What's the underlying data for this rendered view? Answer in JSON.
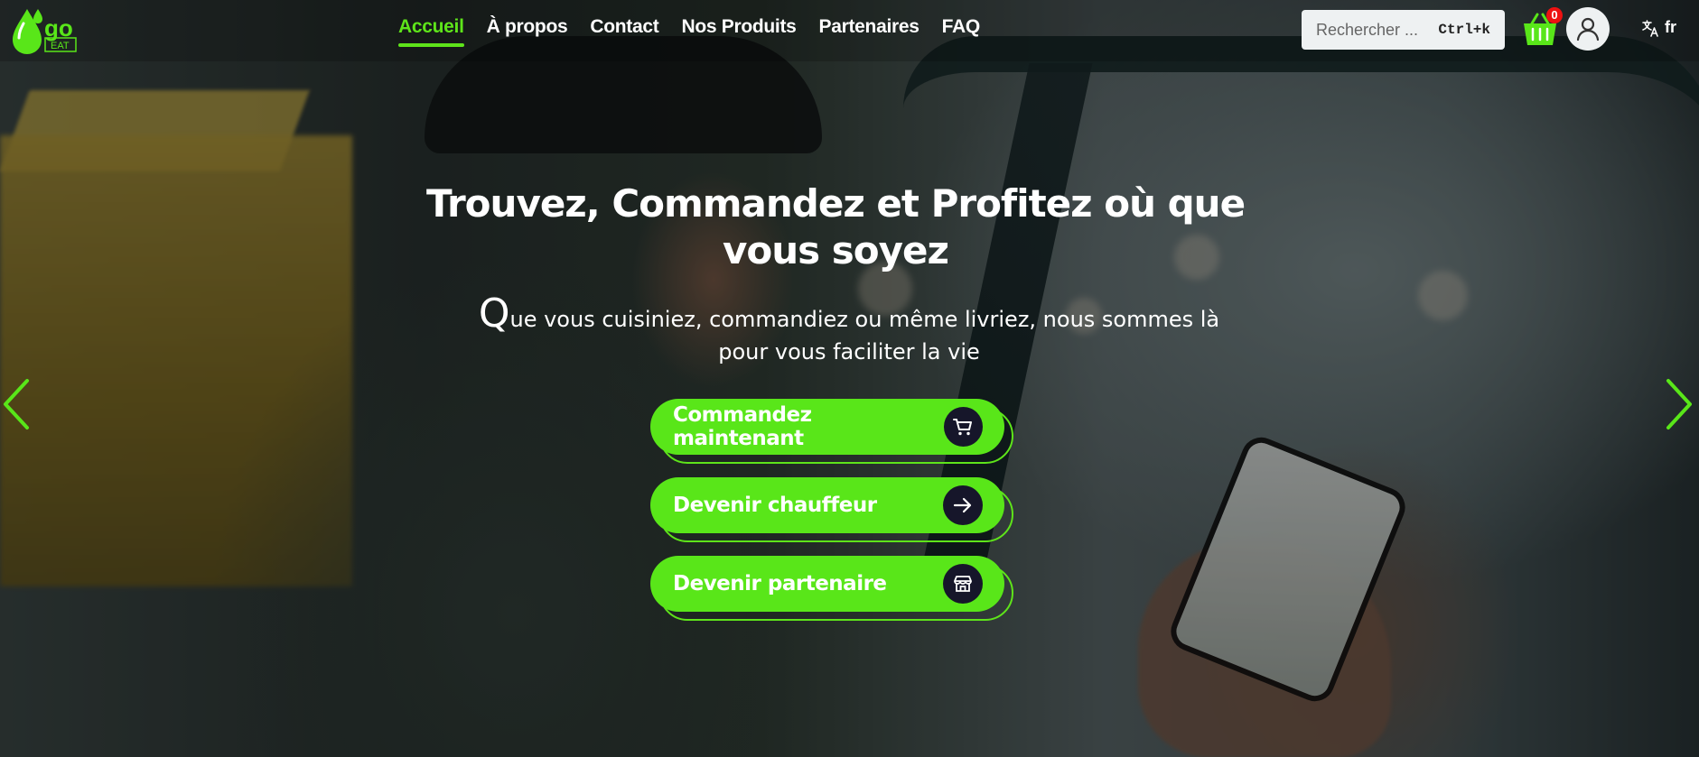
{
  "brand": {
    "logo_letters": "go",
    "logo_sub": "EAT",
    "accent_color": "#59e619"
  },
  "nav": {
    "items": [
      {
        "label": "Accueil",
        "active": true
      },
      {
        "label": "À propos",
        "active": false
      },
      {
        "label": "Contact",
        "active": false
      },
      {
        "label": "Nos Produits",
        "active": false
      },
      {
        "label": "Partenaires",
        "active": false
      },
      {
        "label": "FAQ",
        "active": false
      }
    ]
  },
  "search": {
    "placeholder": "Rechercher ...",
    "shortcut": "Ctrl+k"
  },
  "cart": {
    "count": "0",
    "icon": "basket-icon"
  },
  "user": {
    "icon": "user-icon"
  },
  "language": {
    "label": "fr",
    "icon": "translate-icon"
  },
  "hero": {
    "title": "Trouvez, Commandez et Profitez où que vous soyez",
    "subtitle_first_letter": "Q",
    "subtitle_rest": "ue vous cuisiniez, commandiez ou même livriez, nous sommes là pour vous faciliter la vie",
    "buttons": [
      {
        "label": "Commandez maintenant",
        "icon": "cart-icon"
      },
      {
        "label": "Devenir chauffeur",
        "icon": "arrow-right-icon"
      },
      {
        "label": "Devenir partenaire",
        "icon": "store-icon"
      }
    ]
  },
  "carousel": {
    "prev_icon": "chevron-left-icon",
    "next_icon": "chevron-right-icon"
  }
}
